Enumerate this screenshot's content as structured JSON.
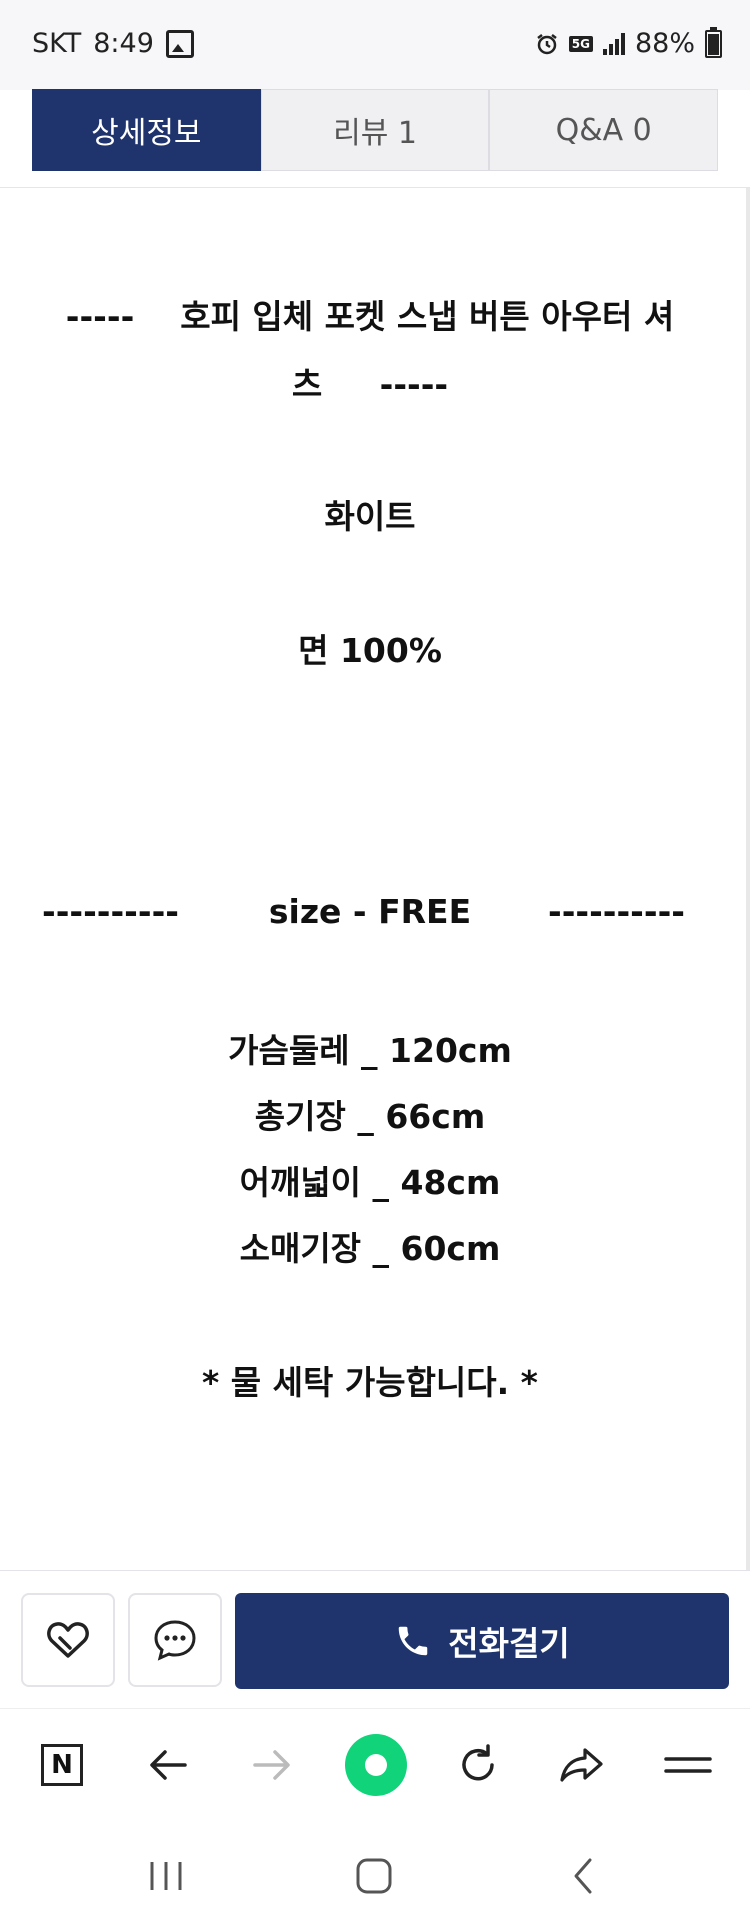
{
  "status_bar": {
    "carrier": "SKT",
    "time": "8:49",
    "network": "5G",
    "battery": "88%"
  },
  "tabs": [
    {
      "label": "상세정보",
      "active": true
    },
    {
      "label": "리뷰 1",
      "active": false
    },
    {
      "label": "Q&A 0",
      "active": false
    }
  ],
  "content": {
    "title_line1": "-----    호피 입체 포켓 스냅 버튼 아우터 셔",
    "title_line2": "츠     -----",
    "color": "화이트",
    "material": "면 100%",
    "size_dashes_left": "----------",
    "size_label": "size - FREE",
    "size_dashes_right": "----------",
    "measurements": [
      "가슴둘레 _ 120cm",
      "총기장 _ 66cm",
      "어깨넓이 _ 48cm",
      "소매기장 _ 60cm"
    ],
    "washing_note": "* 물 세탁 가능합니다. *"
  },
  "action_bar": {
    "call_label": "전화걸기",
    "wish_icon": "heart-icon",
    "chat_icon": "chat-bubble-icon"
  },
  "browser_bar": {
    "logo": "N"
  },
  "colors": {
    "primary": "#1f336d",
    "accent_green": "#10d37a"
  }
}
